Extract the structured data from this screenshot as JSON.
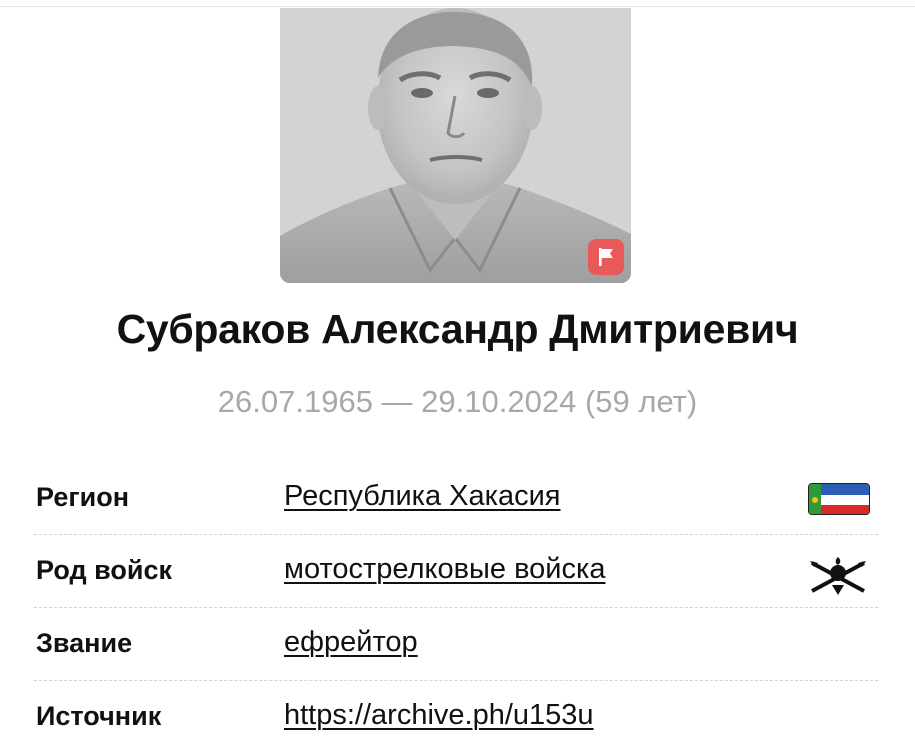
{
  "person": {
    "name": "Субраков Александр Дмитриевич",
    "dates": "26.07.1965 — 29.10.2024 (59 лет)"
  },
  "portrait": {
    "badge_icon": "flag-icon",
    "badge_color": "#e8595a"
  },
  "info": {
    "rows": [
      {
        "label": "Регион",
        "value": "Республика Хакасия",
        "icon": "khakassia-flag-icon"
      },
      {
        "label": "Род войск",
        "value": "мотострелковые войска",
        "icon": "motor-rifle-emblem-icon"
      },
      {
        "label": "Звание",
        "value": "ефрейтор"
      },
      {
        "label": "Источник",
        "value": "https://archive.ph/u153u"
      }
    ]
  }
}
